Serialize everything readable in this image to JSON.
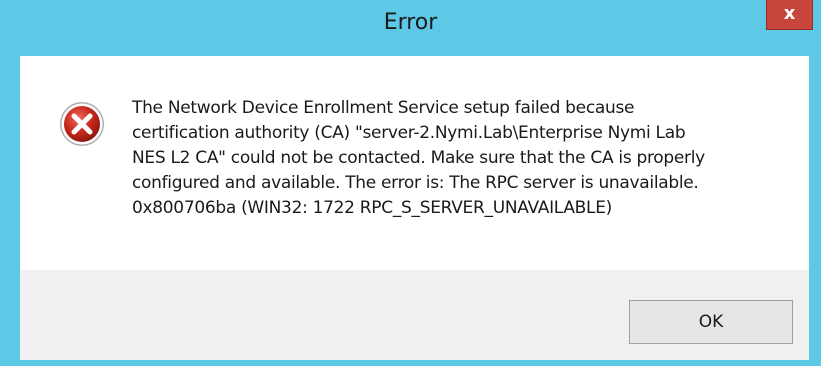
{
  "window": {
    "title": "Error",
    "close_label": "x",
    "titlebar_color": "#5ec9e7",
    "close_color": "#c7453a"
  },
  "dialog": {
    "icon": "error-icon",
    "message_lines": [
      "The Network Device Enrollment Service setup failed because",
      "certification authority (CA) \"server-2.Nymi.Lab\\Enterprise  Nymi Lab",
      "NES L2 CA\" could not be contacted. Make sure that the CA is properly",
      "configured and available. The error is:  The RPC server is unavailable.",
      "0x800706ba (WIN32: 1722 RPC_S_SERVER_UNAVAILABLE)"
    ]
  },
  "buttons": {
    "ok_label": "OK"
  }
}
